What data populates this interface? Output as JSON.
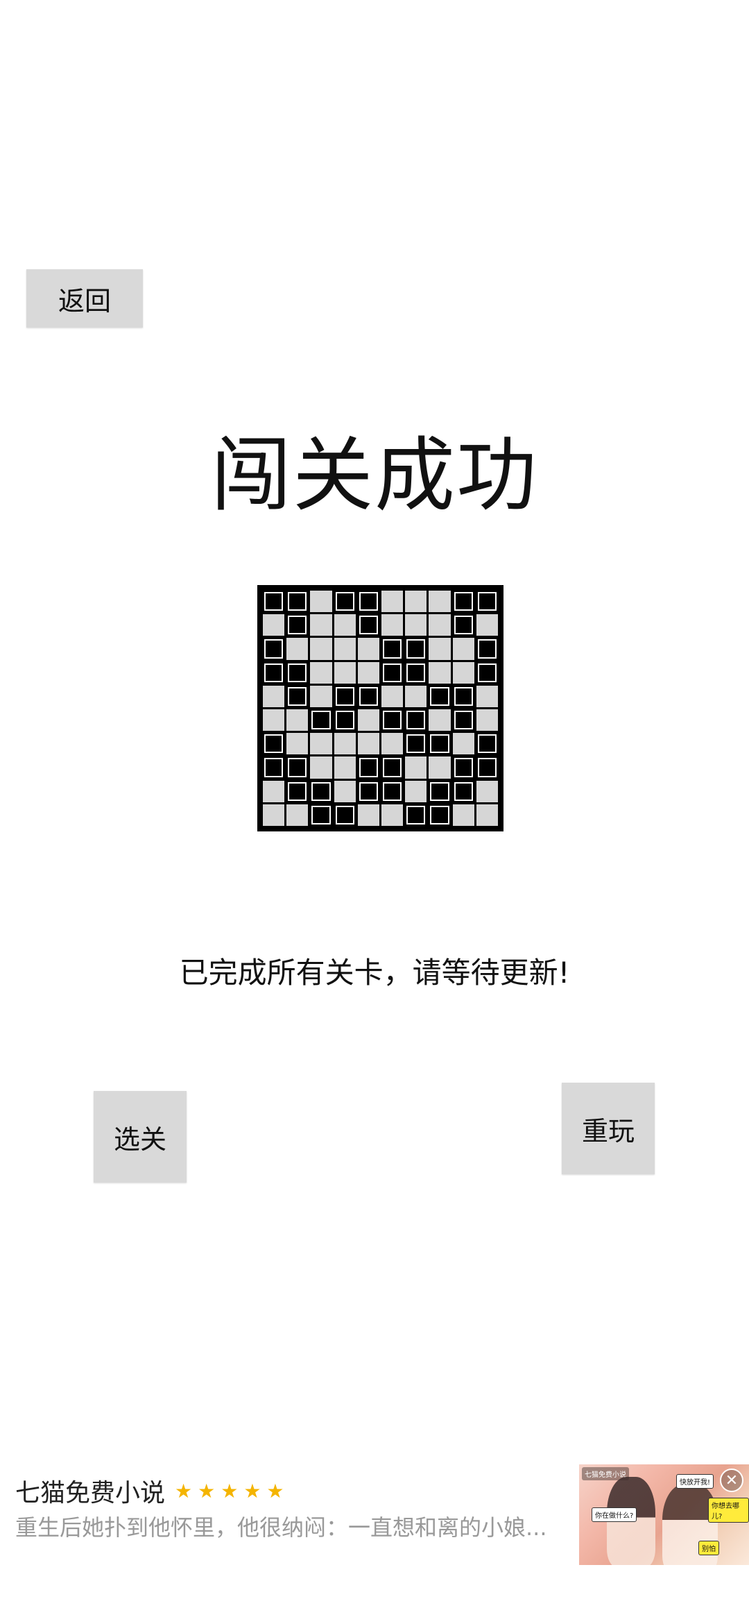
{
  "buttons": {
    "back": "返回",
    "select_level": "选关",
    "replay": "重玩"
  },
  "title": "闯关成功",
  "message": "已完成所有关卡，请等待更新!",
  "board": {
    "size": 10,
    "filled_color": "#000000",
    "empty_color": "#d6d6d6",
    "rows": [
      "1101100011",
      "0100100010",
      "1000011001",
      "1100011001",
      "0101100110",
      "0011011010",
      "1000001101",
      "1100110011",
      "0110110110",
      "0011001100"
    ]
  },
  "ad": {
    "title": "七猫免费小说",
    "stars": "★★★★★",
    "description": "重生后她扑到他怀里，他很纳闷：一直想和离的小娘...",
    "brand": "七猫免费小说",
    "bubbles": [
      "你想去哪儿?",
      "快放开我!",
      "别怕",
      "你在做什么?"
    ],
    "close_icon": "close-icon"
  }
}
